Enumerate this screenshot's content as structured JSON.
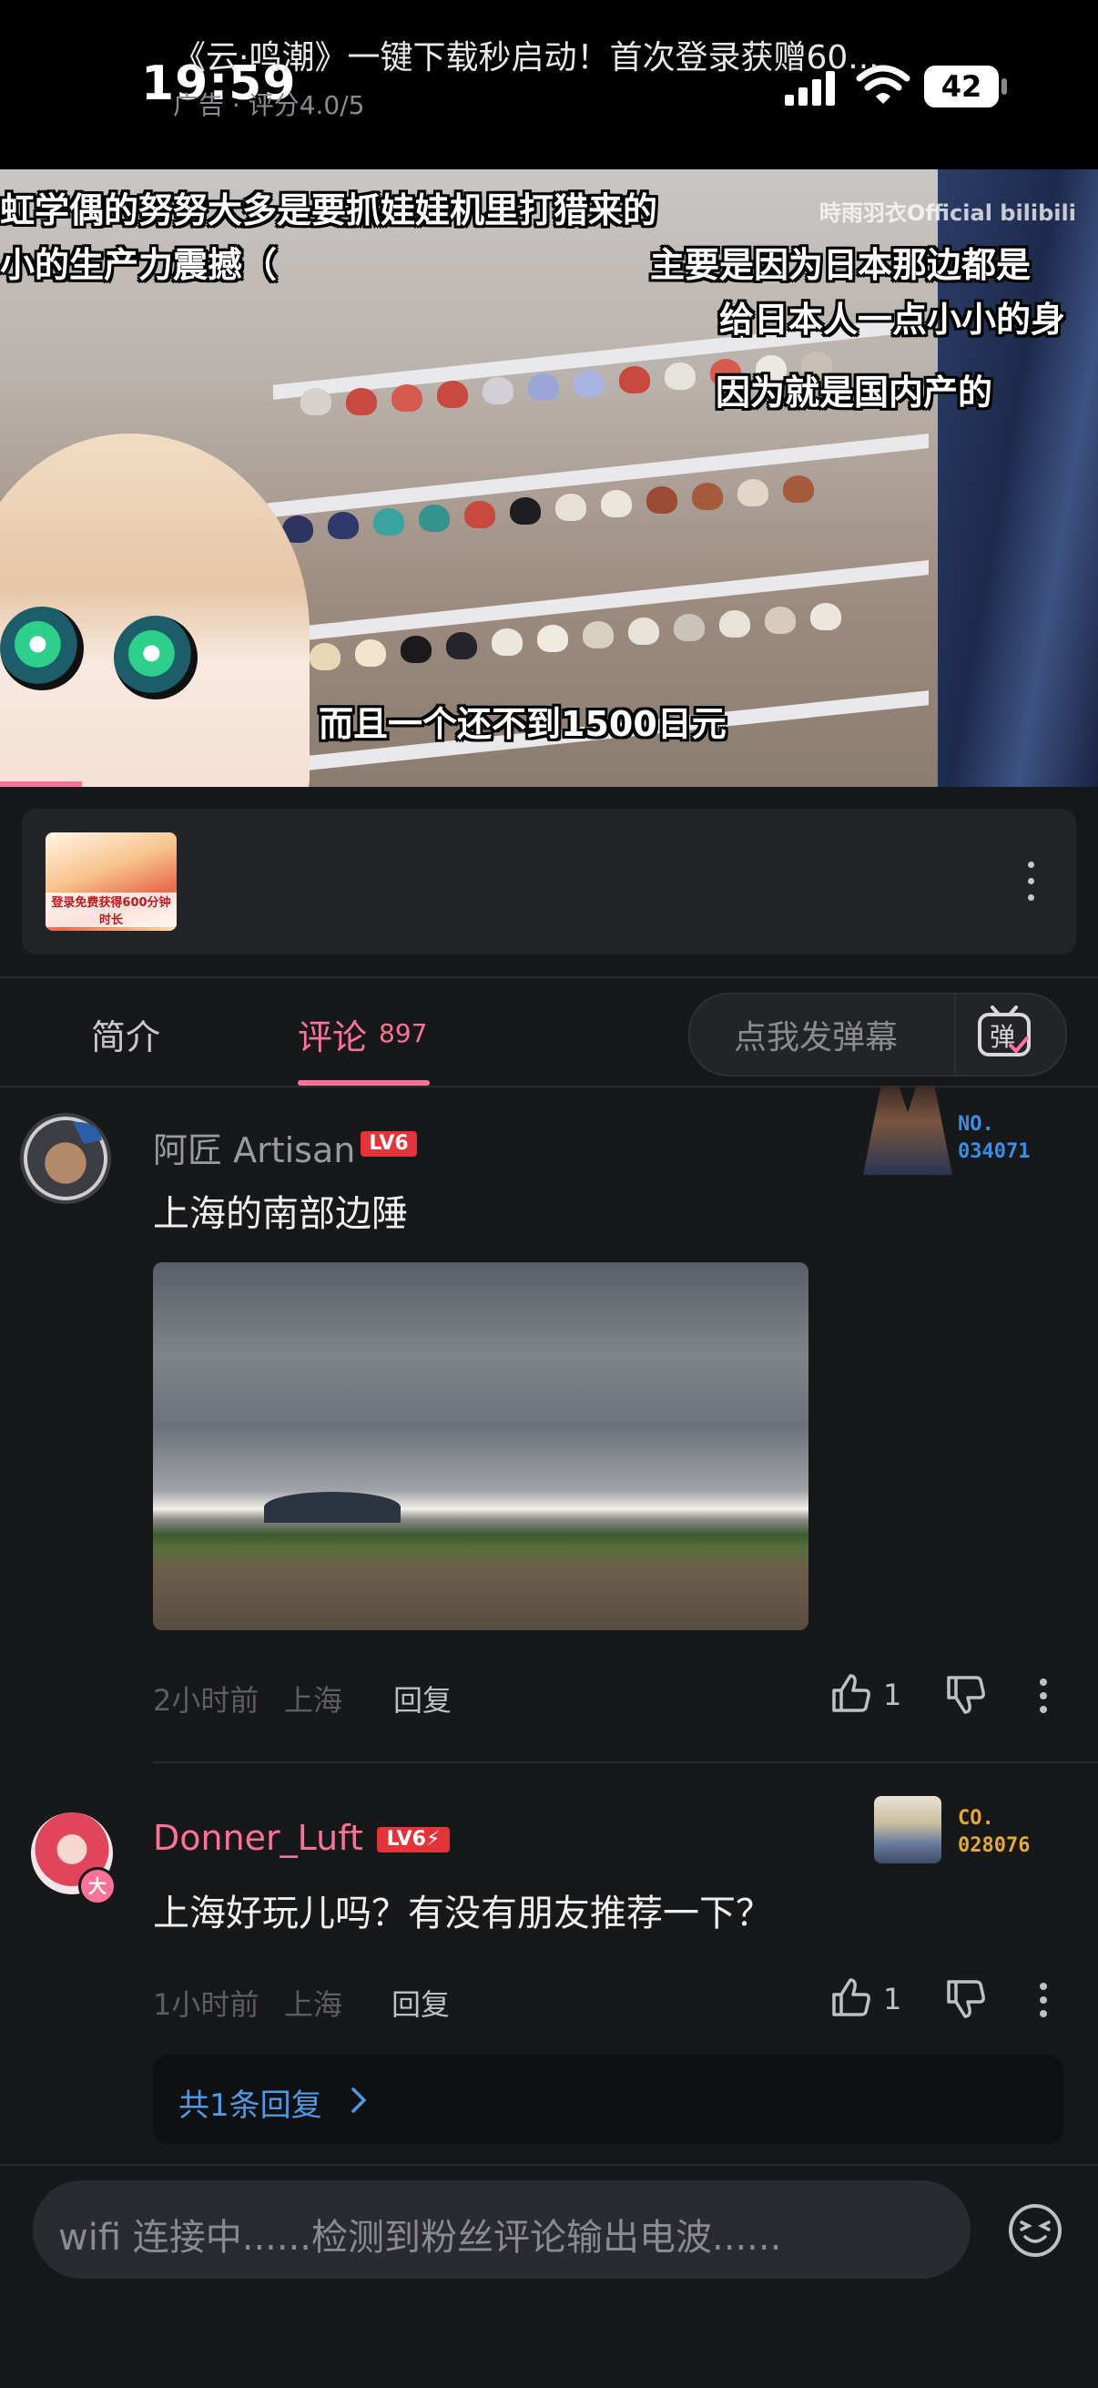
{
  "status_bar": {
    "time": "19:59",
    "battery": "42"
  },
  "video": {
    "subtitles": [
      "虹学偶的努努大多是要抓娃娃机里打猎来的",
      "小的生产力震撼（",
      "主要是因为日本那边都是",
      "给日本人一点小小的身",
      "因为就是国内产的",
      "而且一个还不到1500日元"
    ],
    "watermark": "時雨羽衣Official bilibili"
  },
  "ad": {
    "title": "《云·鸣潮》一键下载秒启动！首次登录获赠60...",
    "meta": "广告 · 评分4.0/5",
    "thumb_text": "登录免费获得600分钟时长"
  },
  "tabs": {
    "intro": "简介",
    "comments": "评论",
    "comments_count": "897",
    "danmaku_placeholder": "点我发弹幕",
    "danmaku_icon_char": "弹"
  },
  "comments": [
    {
      "username": "阿匠 Artisan",
      "level": "LV6",
      "text": "上海的南部边陲",
      "time": "2小时前",
      "location": "上海",
      "reply_label": "回复",
      "likes": "1",
      "medal": [
        "NO.",
        "034071"
      ],
      "medal_color": "#3a8ee6"
    },
    {
      "username": "Donner_Luft",
      "level": "LV6⚡",
      "text": "上海好玩儿吗？有没有朋友推荐一下？",
      "time": "1小时前",
      "location": "上海",
      "reply_label": "回复",
      "likes": "1",
      "medal": [
        "CO.",
        "028076"
      ],
      "medal_color": "#e3a93a",
      "replies_link": "共1条回复",
      "avatar_badge": "大"
    }
  ],
  "input": {
    "placeholder": "wifi 连接中......检测到粉丝评论输出电波......"
  },
  "colors": {
    "accent": "#fb7299",
    "link": "#4e9ae6",
    "level_red": "#e5333a",
    "background": "#17181a"
  }
}
